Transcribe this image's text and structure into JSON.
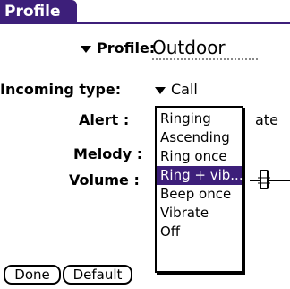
{
  "window": {
    "title": "Profile"
  },
  "fields": {
    "profile_label": "Profile:",
    "profile_value": "Outdoor",
    "incoming_label": "Incoming type:",
    "incoming_value": "Call",
    "alert_label": "Alert :",
    "alert_suffix": "ate",
    "melody_label": "Melody :",
    "volume_label": "Volume :"
  },
  "alert_popup": {
    "options": [
      "Ringing",
      "Ascending",
      "Ring once",
      "Ring + vib...",
      "Beep once",
      "Vibrate",
      "Off"
    ],
    "selected_index": 3
  },
  "buttons": {
    "done": "Done",
    "default": "Default"
  },
  "colors": {
    "accent": "#3d1f7a",
    "background": "#ffffff"
  },
  "icons": {
    "slider_knob": "volume-slider-knob-icon",
    "dropdown": "triangle-down-icon"
  }
}
